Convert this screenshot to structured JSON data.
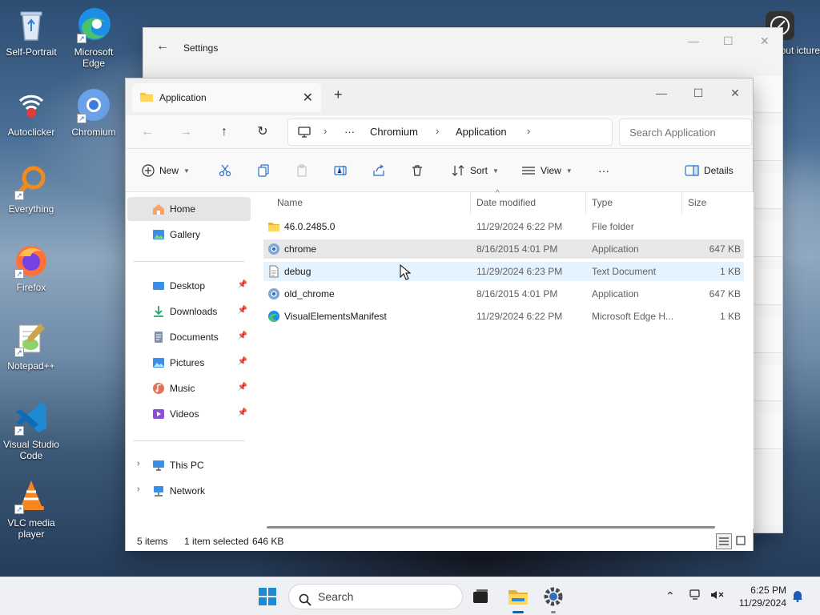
{
  "desktop": {
    "icons": [
      {
        "label": "Self-Portrait"
      },
      {
        "label": "Microsoft Edge"
      },
      {
        "label": "Autoclicker"
      },
      {
        "label": "Chromium"
      },
      {
        "label": "Everything"
      },
      {
        "label": "Firefox"
      },
      {
        "label": "Notepad++"
      },
      {
        "label": "Visual Studio Code"
      },
      {
        "label": "VLC media player"
      },
      {
        "label": "dbout icture"
      }
    ]
  },
  "settings_window": {
    "title": "Settings"
  },
  "explorer": {
    "tab_title": "Application",
    "breadcrumb": {
      "ellipsis": "···",
      "items": [
        "Chromium",
        "Application"
      ]
    },
    "search_placeholder": "Search Application",
    "toolbar": {
      "new_label": "New",
      "sort_label": "Sort",
      "view_label": "View",
      "more_label": "···",
      "details_label": "Details"
    },
    "sidebar": {
      "top": [
        {
          "label": "Home"
        },
        {
          "label": "Gallery"
        }
      ],
      "pinned": [
        {
          "label": "Desktop"
        },
        {
          "label": "Downloads"
        },
        {
          "label": "Documents"
        },
        {
          "label": "Pictures"
        },
        {
          "label": "Music"
        },
        {
          "label": "Videos"
        }
      ],
      "bottom": [
        {
          "label": "This PC"
        },
        {
          "label": "Network"
        }
      ]
    },
    "columns": {
      "name": "Name",
      "date": "Date modified",
      "type": "Type",
      "size": "Size"
    },
    "files": [
      {
        "name": "46.0.2485.0",
        "date": "11/29/2024 6:22 PM",
        "type": "File folder",
        "size": "",
        "icon": "folder-icon"
      },
      {
        "name": "chrome",
        "date": "8/16/2015 4:01 PM",
        "type": "Application",
        "size": "647 KB",
        "icon": "chromium-app-icon"
      },
      {
        "name": "debug",
        "date": "11/29/2024 6:23 PM",
        "type": "Text Document",
        "size": "1 KB",
        "icon": "text-file-icon"
      },
      {
        "name": "old_chrome",
        "date": "8/16/2015 4:01 PM",
        "type": "Application",
        "size": "647 KB",
        "icon": "chromium-app-icon"
      },
      {
        "name": "VisualElementsManifest",
        "date": "11/29/2024 6:22 PM",
        "type": "Microsoft Edge H...",
        "size": "1 KB",
        "icon": "edge-html-icon"
      }
    ],
    "status": {
      "items": "5 items",
      "selected": "1 item selected",
      "size": "646 KB"
    }
  },
  "taskbar": {
    "search_placeholder": "Search",
    "time": "6:25 PM",
    "date": "11/29/2024"
  },
  "colors": {
    "accent": "#0067c0",
    "folder": "#f4c53f",
    "selected_row": "#e8e8e8",
    "hover_row": "#e5f3ff"
  }
}
